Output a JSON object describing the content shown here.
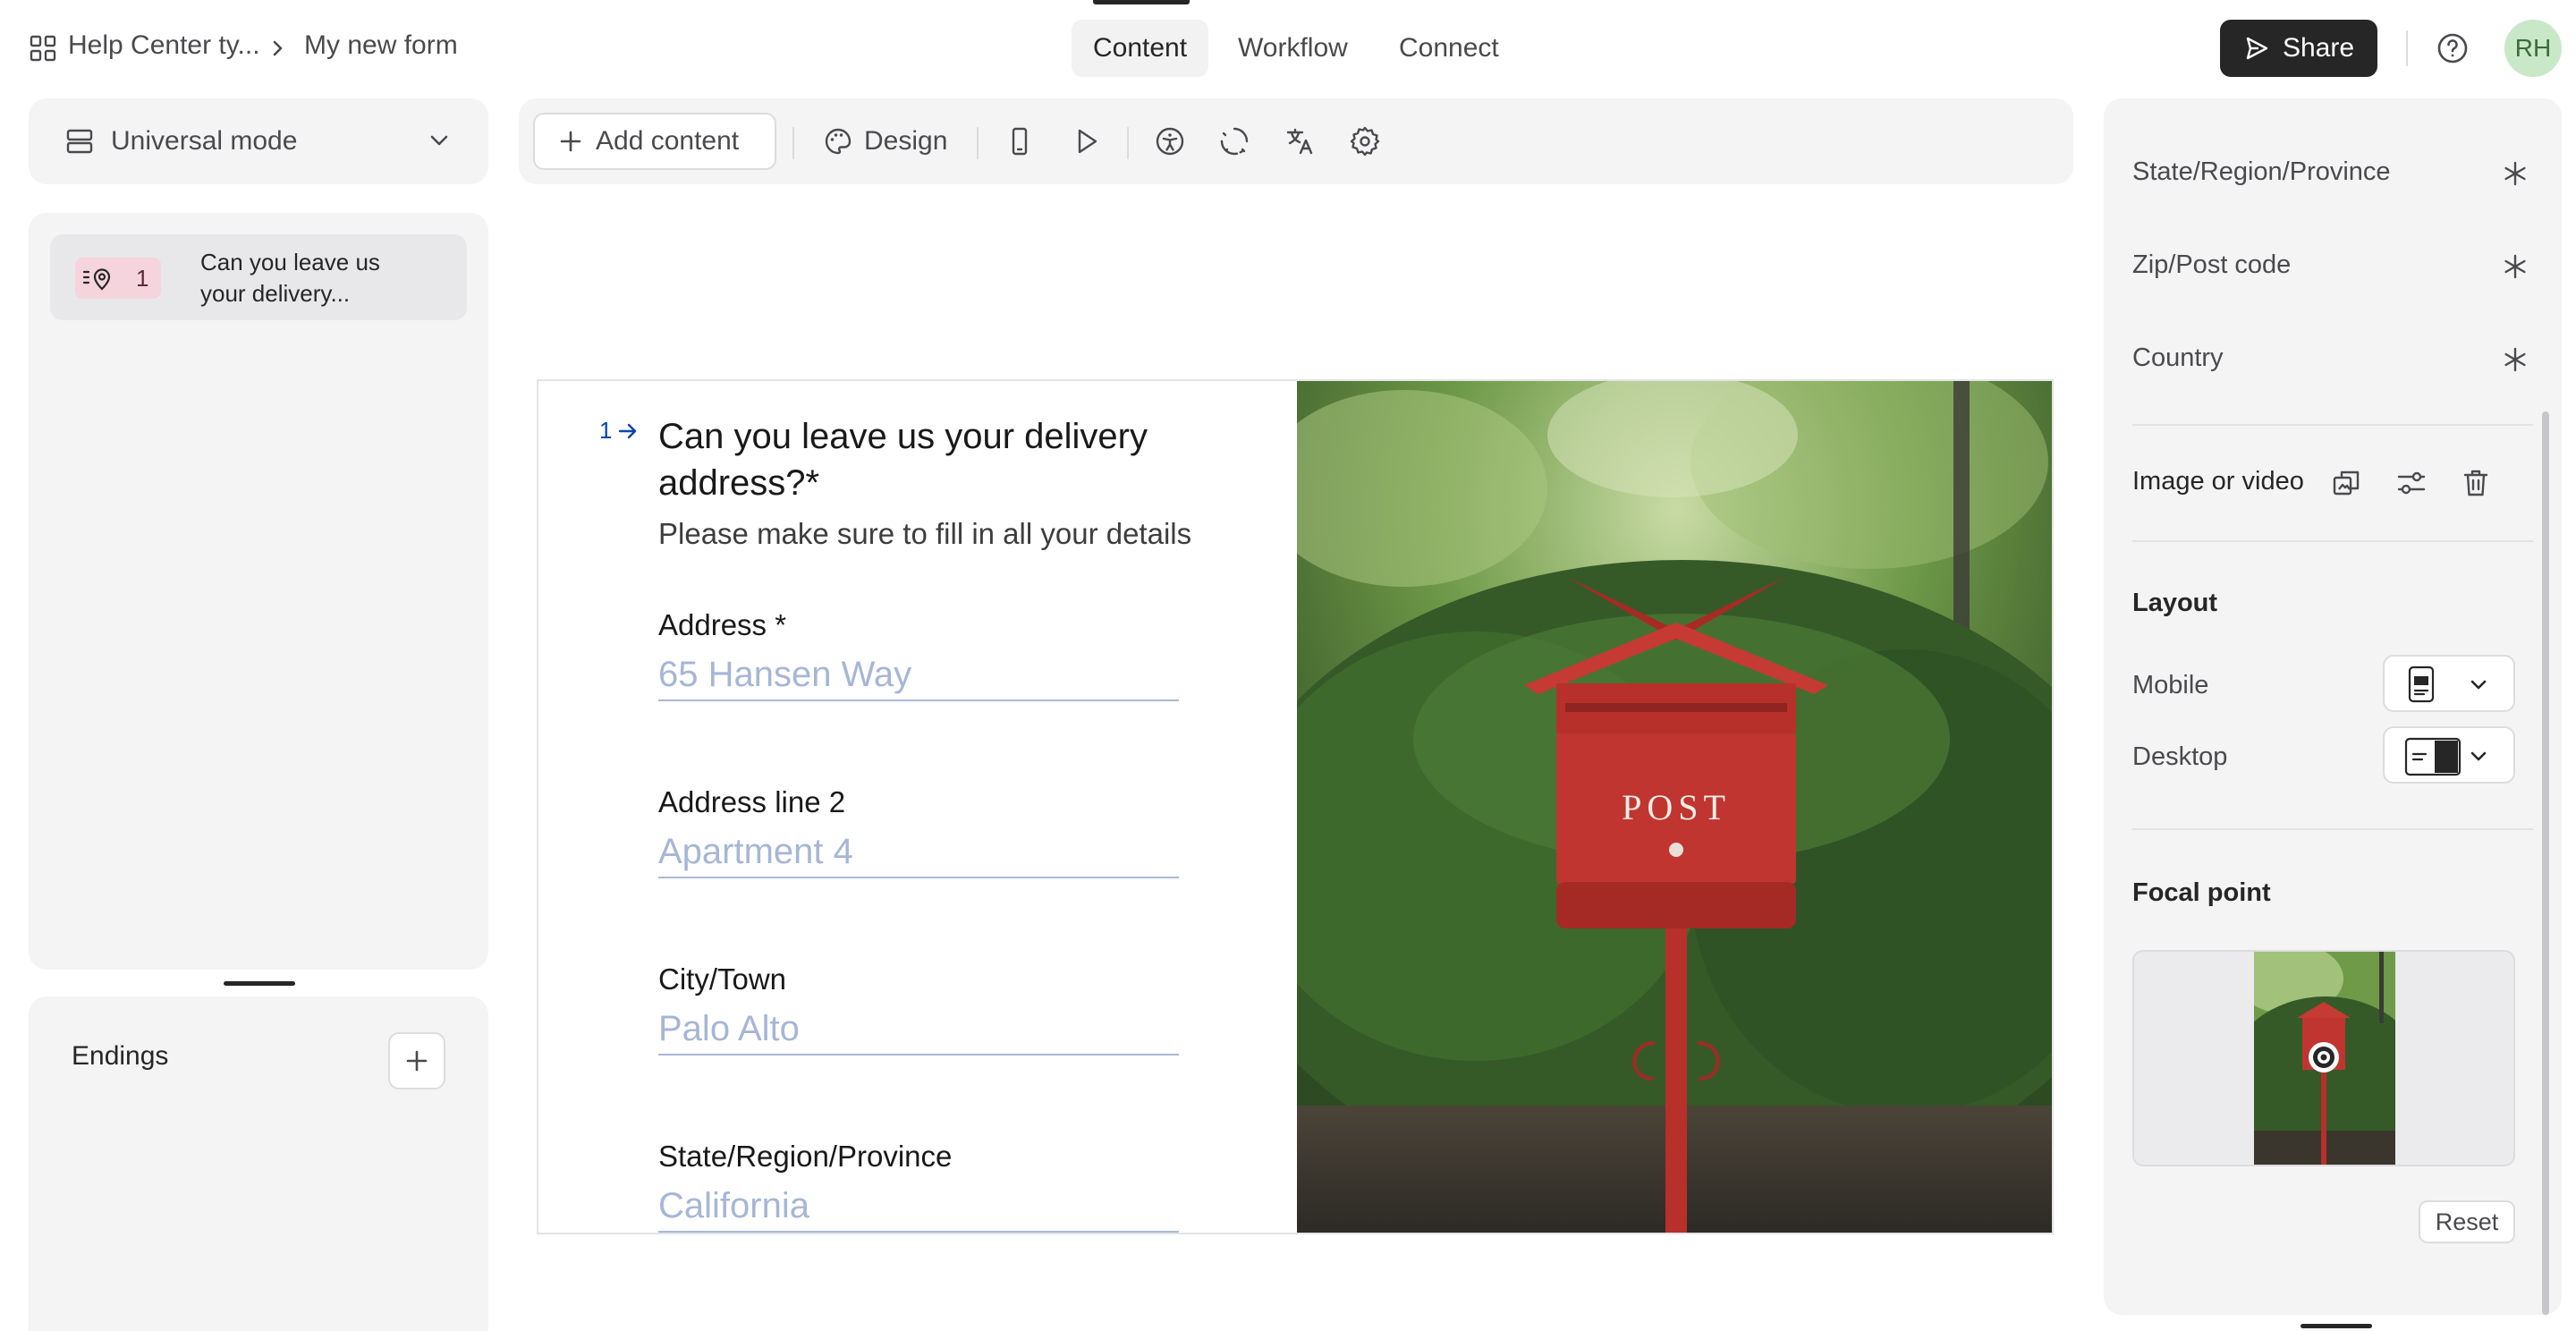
{
  "topbar": {
    "breadcrumb_workspace": "Help Center ty...",
    "breadcrumb_form": "My new form",
    "tabs": [
      {
        "label": "Content"
      },
      {
        "label": "Workflow"
      },
      {
        "label": "Connect"
      }
    ],
    "share_label": "Share",
    "avatar_initials": "RH"
  },
  "sidebar": {
    "mode_label": "Universal mode",
    "questions": [
      {
        "number": "1",
        "title": "Can you leave us your delivery..."
      }
    ],
    "endings_label": "Endings"
  },
  "toolbar": {
    "add_content_label": "Add content",
    "design_label": "Design",
    "icons": [
      "mobile-preview-icon",
      "play-icon",
      "accessibility-icon",
      "loading-icon",
      "translate-icon",
      "settings-icon"
    ]
  },
  "form": {
    "question_number": "1",
    "question_title": "Can you leave us your delivery address?*",
    "question_description": "Please make sure to fill in all your details",
    "fields": [
      {
        "label": "Address *",
        "placeholder": "65 Hansen Way"
      },
      {
        "label": "Address line 2",
        "placeholder": "Apartment 4"
      },
      {
        "label": "City/Town",
        "placeholder": "Palo Alto"
      },
      {
        "label": "State/Region/Province",
        "placeholder": "California"
      }
    ],
    "mailbox_text": "POST"
  },
  "right_panel": {
    "fields": [
      {
        "label": "State/Region/Province"
      },
      {
        "label": "Zip/Post code"
      },
      {
        "label": "Country"
      }
    ],
    "image_or_video_label": "Image or video",
    "layout_heading": "Layout",
    "mobile_label": "Mobile",
    "desktop_label": "Desktop",
    "focal_point_heading": "Focal point",
    "reset_label": "Reset"
  },
  "colors": {
    "accent_dark": "#262627",
    "badge_pink": "#f6d4dd",
    "question_blue": "#0445af",
    "avatar_green": "#c9e8c8",
    "mailbox_red": "#b8302a"
  }
}
